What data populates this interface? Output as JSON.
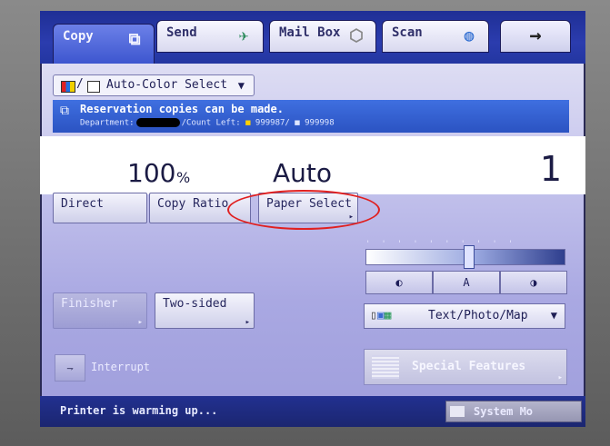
{
  "tabs": [
    {
      "label": "Copy",
      "icon": "copy-icon",
      "active": true
    },
    {
      "label": "Send",
      "icon": "paper-plane-icon",
      "active": false
    },
    {
      "label": "Mail Box",
      "icon": "mailbox-icon",
      "active": false
    },
    {
      "label": "Scan",
      "icon": "scan-globe-icon",
      "active": false
    }
  ],
  "next_tab": {
    "label": "→",
    "icon": "arrow-right-icon"
  },
  "color_select": {
    "separator": "/",
    "value": "Auto-Color Select",
    "chevron": "▼"
  },
  "message": {
    "line1": "Reservation copies can be made.",
    "department_label": "Department:",
    "count_left_label": "/Count Left:",
    "color_count": "999987",
    "separator": "/",
    "bw_count": "999998"
  },
  "readout": {
    "ratio": "100",
    "ratio_unit": "%",
    "paper": "Auto",
    "copies": "1"
  },
  "buttons": {
    "direct": "Direct",
    "copy_ratio": "Copy Ratio",
    "paper_select": "Paper Select",
    "finisher": "Finisher",
    "two_sided": "Two-sided",
    "interrupt": "Interrupt",
    "special_features": "Special Features"
  },
  "density": {
    "lighter": "◐",
    "auto": "A",
    "darker": "◑",
    "level": 0.5
  },
  "image_mode": {
    "value": "Text/Photo/Map",
    "chevron": "▼"
  },
  "status": {
    "message": "Printer is warming up...",
    "system_monitor": "System Mo"
  },
  "colors": {
    "highlight": "#e02020",
    "topbar": "#2336a1",
    "message_bg": "#2b53c2"
  }
}
